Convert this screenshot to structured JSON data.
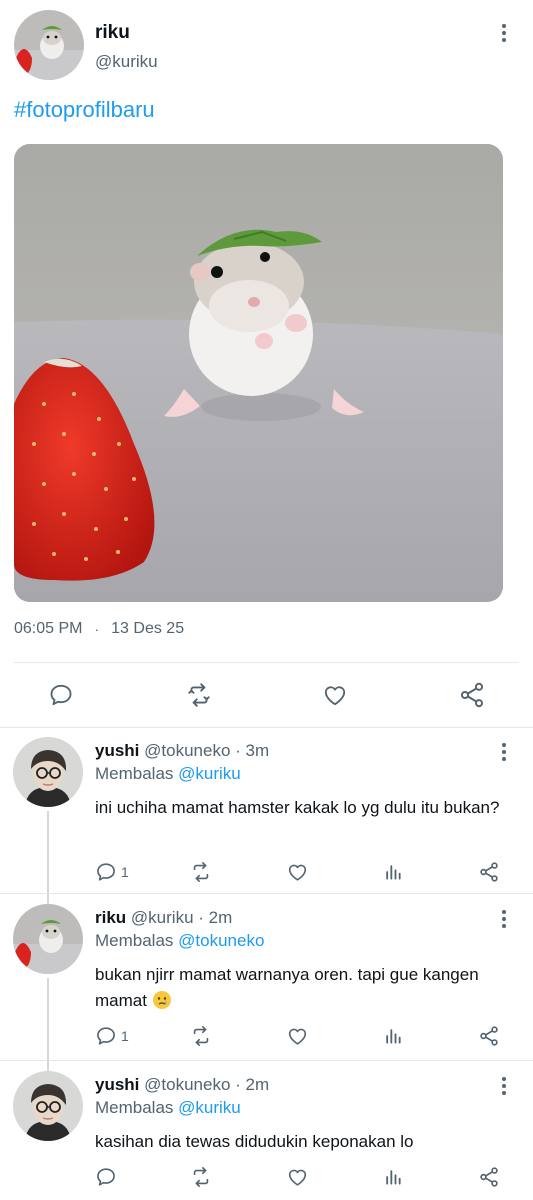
{
  "main_tweet": {
    "name": "riku",
    "handle": "@kuriku",
    "hashtag": "#fotoprofilbaru",
    "time": "06:05 PM",
    "separator": "·",
    "date": "13 Des 25",
    "photo_description_icon": "hamster-strawberry-photo"
  },
  "icons": {
    "more": "vertical-dots-icon",
    "reply": "speech-bubble-icon",
    "retweet": "retweet-icon",
    "like": "heart-icon",
    "views": "bar-chart-icon",
    "share": "share-icon"
  },
  "colors": {
    "link": "#1d9bf0",
    "text": "#0f1419",
    "muted": "#536471",
    "border": "#e6e9eb",
    "thread_line": "#cfd9de"
  },
  "replies": [
    {
      "name": "yushi",
      "handle": "@tokuneko",
      "time": "· 3m",
      "replying_prefix": "Membalas",
      "replying_to": "@kuriku",
      "text": "ini uchiha mamat hamster kakak lo yg dulu itu bukan?",
      "reply_count": "1",
      "avatar": "person-glasses-avatar"
    },
    {
      "name": "riku",
      "handle": "@kuriku",
      "time": "· 2m",
      "replying_prefix": "Membalas",
      "replying_to": "@tokuneko",
      "text": "bukan njirr mamat warnanya oren. tapi gue kangen mamat",
      "emoji": "crying-face-emoji",
      "reply_count": "1",
      "avatar": "hamster-avatar"
    },
    {
      "name": "yushi",
      "handle": "@tokuneko",
      "time": "· 2m",
      "replying_prefix": "Membalas",
      "replying_to": "@kuriku",
      "text": "kasihan dia tewas didudukin keponakan lo",
      "reply_count": "",
      "avatar": "person-glasses-avatar"
    }
  ]
}
